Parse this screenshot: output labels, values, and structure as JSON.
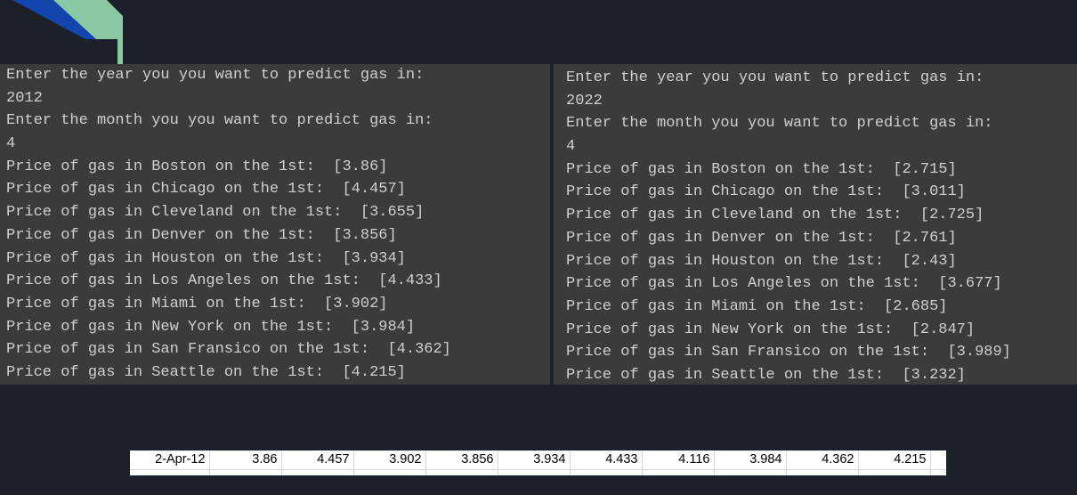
{
  "decoration": {
    "colors": {
      "background": "#1b2029",
      "blue": "#1345ad",
      "green": "#8ac8a4",
      "console_bg": "#3b3b3b",
      "console_text": "#cfcfcf"
    }
  },
  "left_console": {
    "lines": [
      "Enter the year you you want to predict gas in:",
      "2012",
      "Enter the month you you want to predict gas in:",
      "4",
      "Price of gas in Boston on the 1st:  [3.86]",
      "Price of gas in Chicago on the 1st:  [4.457]",
      "Price of gas in Cleveland on the 1st:  [3.655]",
      "Price of gas in Denver on the 1st:  [3.856]",
      "Price of gas in Houston on the 1st:  [3.934]",
      "Price of gas in Los Angeles on the 1st:  [4.433]",
      "Price of gas in Miami on the 1st:  [3.902]",
      "Price of gas in New York on the 1st:  [3.984]",
      "Price of gas in San Fransico on the 1st:  [4.362]",
      "Price of gas in Seattle on the 1st:  [4.215]"
    ]
  },
  "right_console": {
    "lines": [
      "Enter the year you you want to predict gas in:",
      "2022",
      "Enter the month you you want to predict gas in:",
      "4",
      "Price of gas in Boston on the 1st:  [2.715]",
      "Price of gas in Chicago on the 1st:  [3.011]",
      "Price of gas in Cleveland on the 1st:  [2.725]",
      "Price of gas in Denver on the 1st:  [2.761]",
      "Price of gas in Houston on the 1st:  [2.43]",
      "Price of gas in Los Angeles on the 1st:  [3.677]",
      "Price of gas in Miami on the 1st:  [2.685]",
      "Price of gas in New York on the 1st:  [2.847]",
      "Price of gas in San Fransico on the 1st:  [3.989]",
      "Price of gas in Seattle on the 1st:  [3.232]"
    ]
  },
  "spreadsheet": {
    "row": [
      "2-Apr-12",
      "3.86",
      "4.457",
      "3.902",
      "3.856",
      "3.934",
      "4.433",
      "4.116",
      "3.984",
      "4.362",
      "4.215"
    ]
  }
}
